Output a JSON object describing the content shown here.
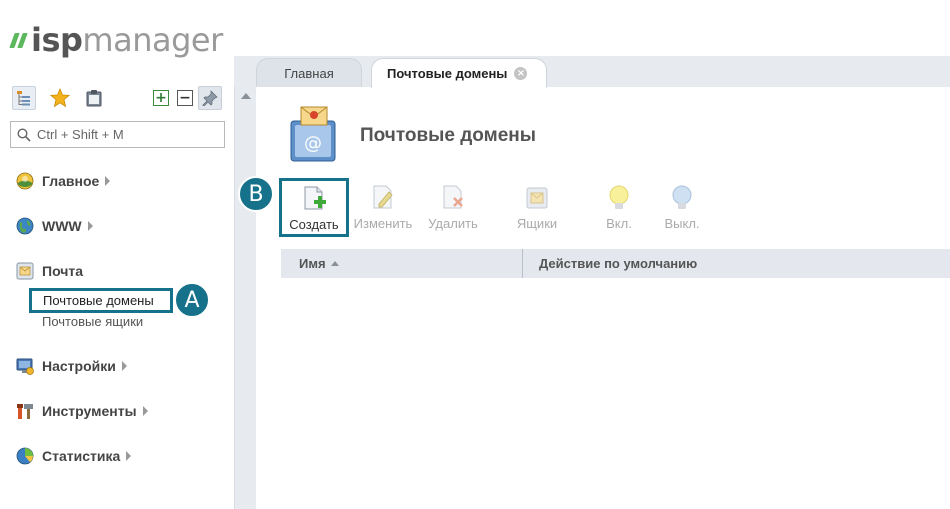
{
  "app": {
    "logo_text_bold": "isp",
    "logo_text_rest": "manager"
  },
  "search": {
    "placeholder": "Ctrl + Shift + M"
  },
  "sidebar": {
    "groups": [
      {
        "label": "Главное",
        "icon": "home-icon"
      },
      {
        "label": "WWW",
        "icon": "globe-icon"
      },
      {
        "label": "Почта",
        "icon": "mail-icon",
        "items": [
          "Почтовые домены",
          "Почтовые ящики"
        ]
      },
      {
        "label": "Настройки",
        "icon": "settings-monitor-icon"
      },
      {
        "label": "Инструменты",
        "icon": "tools-icon"
      },
      {
        "label": "Статистика",
        "icon": "pie-chart-icon"
      }
    ]
  },
  "tabs": [
    {
      "label": "Главная",
      "active": false
    },
    {
      "label": "Почтовые домены",
      "active": true
    }
  ],
  "main": {
    "title": "Почтовые домены",
    "toolbar": [
      {
        "label": "Создать",
        "enabled": true
      },
      {
        "label": "Изменить",
        "enabled": false
      },
      {
        "label": "Удалить",
        "enabled": false
      },
      {
        "label": "Ящики",
        "enabled": false
      },
      {
        "label": "Вкл.",
        "enabled": false
      },
      {
        "label": "Выкл.",
        "enabled": false
      }
    ],
    "columns": [
      "Имя",
      "Действие по умолчанию"
    ]
  },
  "annotations": {
    "a": "A",
    "b": "B"
  },
  "colors": {
    "accent": "#16718b",
    "brand": "#5cb85c"
  }
}
